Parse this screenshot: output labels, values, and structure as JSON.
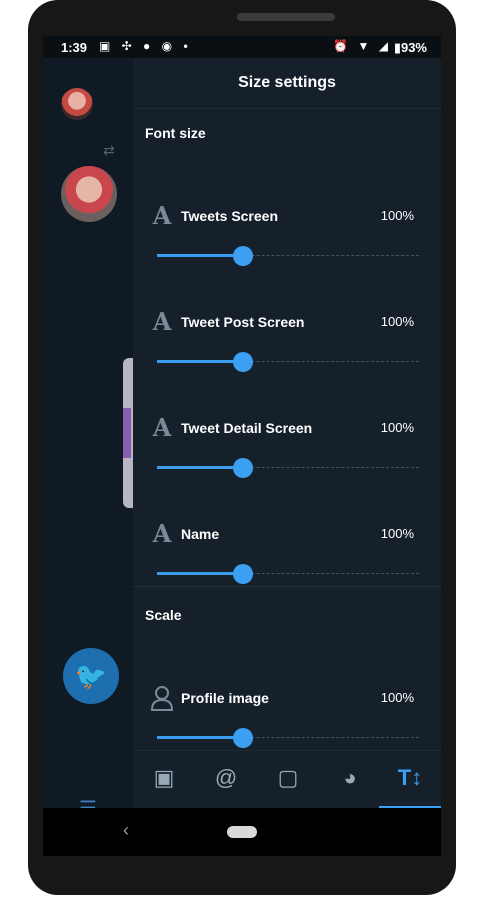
{
  "status_bar": {
    "time": "1:39",
    "left_icons": "▣ ✣ ● ◉ •",
    "right_icons": "⏰ ▼ ◢",
    "battery": "▮93%"
  },
  "panel": {
    "title": "Size settings",
    "font_size_section": {
      "label": "Font size",
      "items": [
        {
          "label": "Tweets Screen",
          "value": "100%",
          "icon": "font-icon",
          "level": 0.33
        },
        {
          "label": "Tweet Post Screen",
          "value": "100%",
          "icon": "font-icon",
          "level": 0.33
        },
        {
          "label": "Tweet Detail Screen",
          "value": "100%",
          "icon": "font-icon",
          "level": 0.33
        },
        {
          "label": "Name",
          "value": "100%",
          "icon": "font-icon",
          "level": 0.33
        }
      ]
    },
    "scale_section": {
      "label": "Scale",
      "items": [
        {
          "label": "Profile image",
          "value": "100%",
          "icon": "profile-icon",
          "level": 0.33
        }
      ]
    }
  },
  "tab_bar": {
    "tabs": [
      {
        "name": "image",
        "glyph": "▣"
      },
      {
        "name": "mention",
        "glyph": "@"
      },
      {
        "name": "comment",
        "glyph": "▢"
      },
      {
        "name": "palette",
        "glyph": "◕"
      },
      {
        "name": "text-size",
        "glyph": "T↕",
        "active": true
      }
    ]
  },
  "colors": {
    "accent": "#3b9ff2",
    "panel_bg": "#16202b",
    "icon_gray": "#7b8a99"
  }
}
